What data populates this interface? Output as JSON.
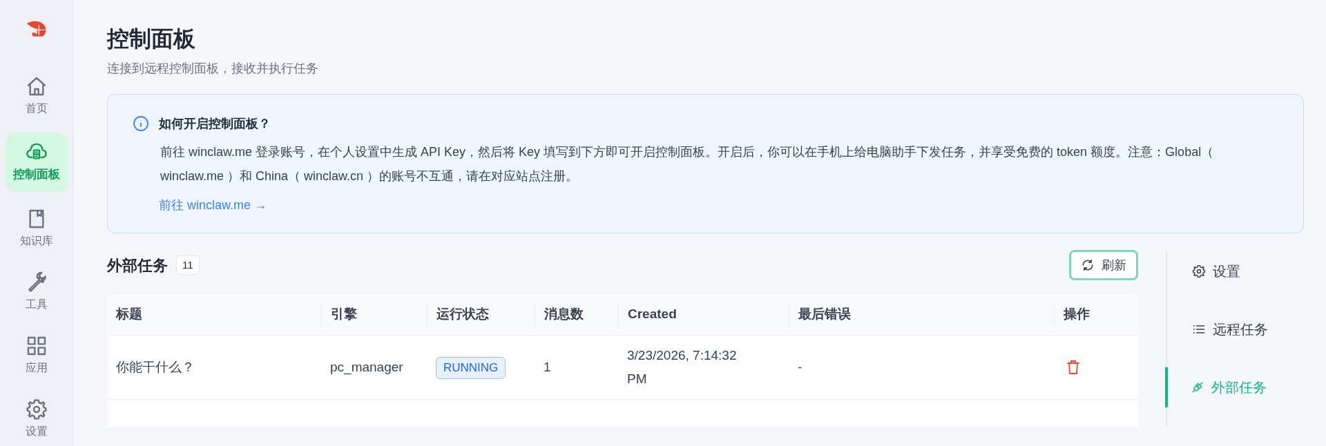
{
  "sidebar": {
    "items": [
      {
        "kind": "home",
        "label": "首页",
        "selected": false
      },
      {
        "kind": "cloud",
        "label": "控制面板",
        "selected": true
      },
      {
        "kind": "book",
        "label": "知识库",
        "selected": false
      },
      {
        "kind": "wrench",
        "label": "工具",
        "selected": false
      },
      {
        "kind": "grid",
        "label": "应用",
        "selected": false
      },
      {
        "kind": "gear",
        "label": "设置",
        "selected": false
      }
    ]
  },
  "header": {
    "title": "控制面板",
    "subtitle": "连接到远程控制面板，接收并执行任务"
  },
  "info_card": {
    "heading": "如何开启控制面板？",
    "body": "前往 winclaw.me 登录账号，在个人设置中生成 API Key，然后将 Key 填写到下方即可开启控制面板。开启后，你可以在手机上给电脑助手下发任务，并享受免费的 token 额度。注意：Global（ winclaw.me ）和 China（ winclaw.cn ）的账号不互通，请在对应站点注册。",
    "link": "前往 winclaw.me →"
  },
  "tasks": {
    "title": "外部任务",
    "count": "11",
    "refresh_button": "刷新",
    "table": {
      "columns": [
        "标题",
        "引擎",
        "运行状态",
        "消息数",
        "Created",
        "最后错误",
        "操作"
      ],
      "rows": [
        {
          "title": "你能干什么？",
          "engine": "pc_manager",
          "status": "RUNNING",
          "messages": "1",
          "created": "3/23/2026, 7:14:32 PM",
          "last_error": "-"
        }
      ]
    }
  },
  "side_tabs": [
    {
      "kind": "gear",
      "label": "设置",
      "selected": false
    },
    {
      "kind": "list",
      "label": "远程任务",
      "selected": false
    },
    {
      "kind": "plug",
      "label": "外部任务",
      "selected": true
    }
  ]
}
